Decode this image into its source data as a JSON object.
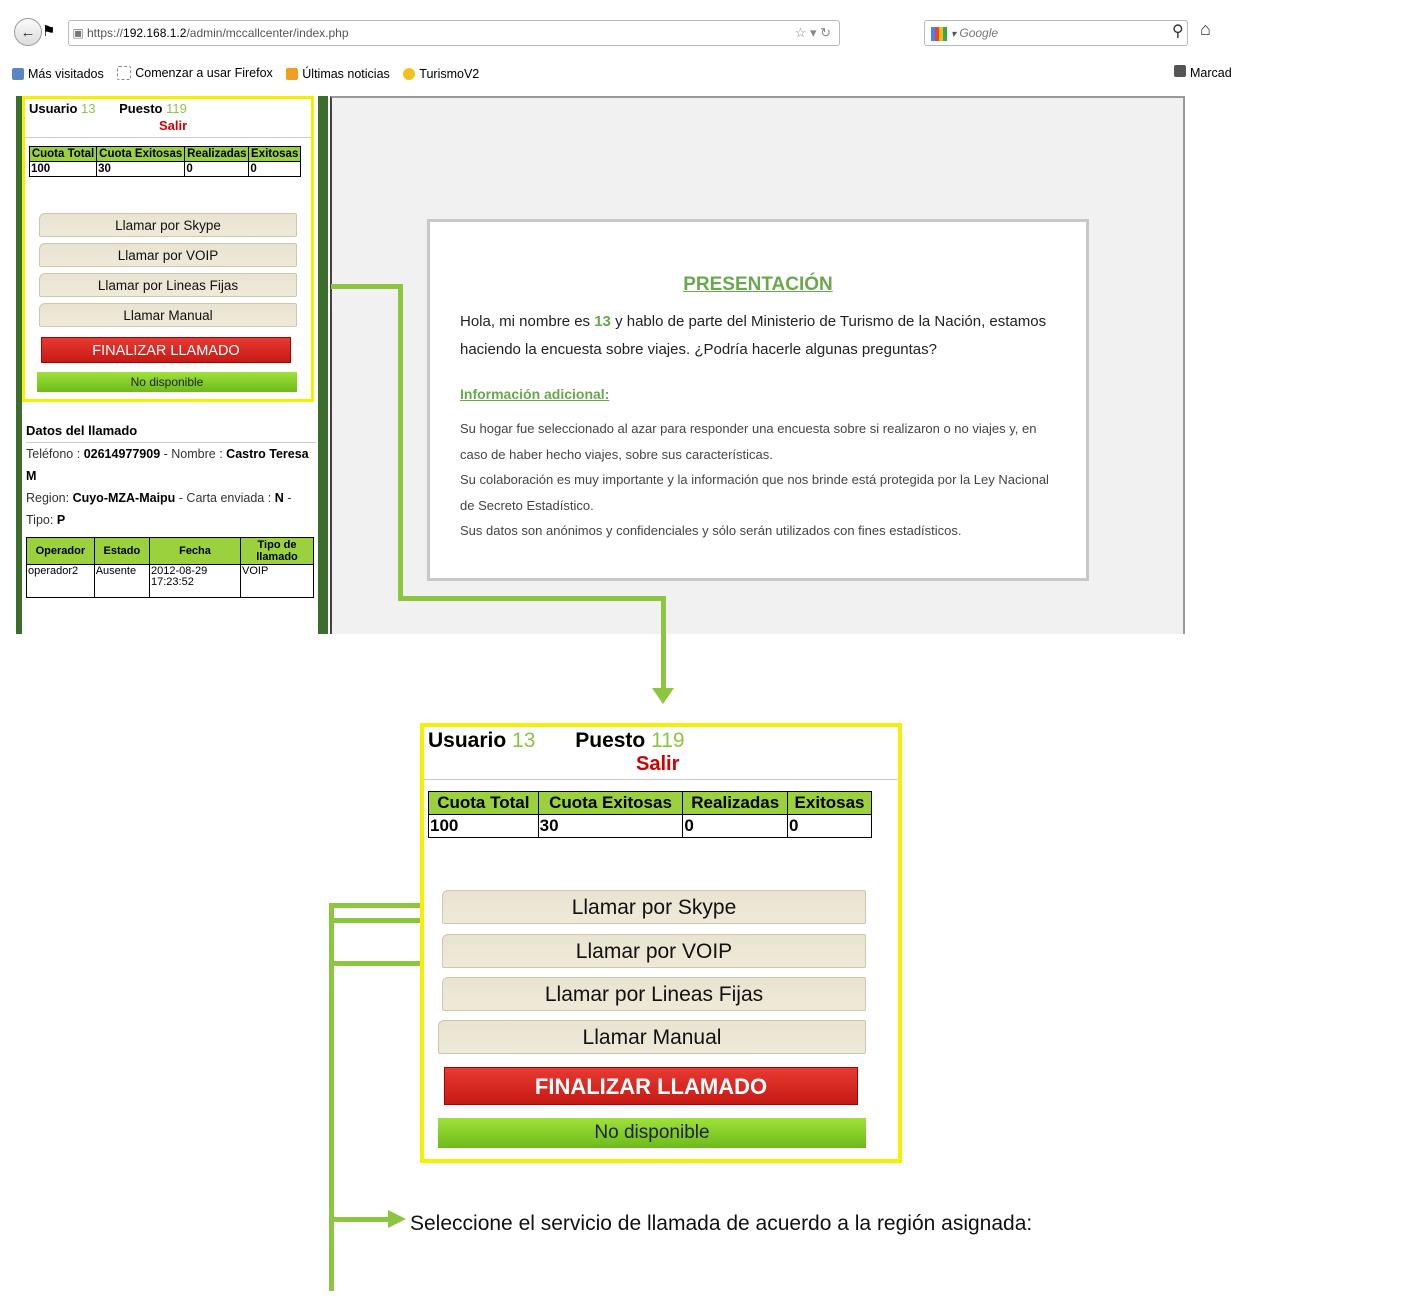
{
  "browser": {
    "url_prefix": "https://",
    "url_host": "192.168.1.2",
    "url_path": "/admin/mccallcenter/index.php",
    "search_placeholder": "Google",
    "bookmarks": [
      "Más visitados",
      "Comenzar a usar Firefox",
      "Últimas noticias",
      "TurismoV2"
    ],
    "bookmarks_right": "Marcad"
  },
  "panel": {
    "usuario_label": "Usuario",
    "usuario_value": "13",
    "puesto_label": "Puesto",
    "puesto_value": "119",
    "salir": "Salir",
    "quota_headers": [
      "Cuota Total",
      "Cuota Exitosas",
      "Realizadas",
      "Exitosas"
    ],
    "quota_values": [
      "100",
      "30",
      "0",
      "0"
    ],
    "buttons": [
      "Llamar por Skype",
      "Llamar por VOIP",
      "Llamar por Lineas Fijas",
      "Llamar Manual"
    ],
    "finalizar": "FINALIZAR LLAMADO",
    "status": "No disponible"
  },
  "datos": {
    "title": "Datos del llamado",
    "telefono_label": "Teléfono : ",
    "telefono": "02614977909",
    "nombre_label": " - Nombre : ",
    "nombre": "Castro Teresa M",
    "region_label": "Region: ",
    "region": "Cuyo-MZA-Maipu",
    "carta_label": " - Carta enviada : ",
    "carta": "N",
    "tipo_label": " - Tipo: ",
    "tipo": "P",
    "table_headers": [
      "Operador",
      "Estado",
      "Fecha",
      "Tipo de llamado"
    ],
    "table_row": [
      "operador2",
      "Ausente",
      "2012-08-29 17:23:52",
      "VOIP"
    ]
  },
  "presentacion": {
    "title": "PRESENTACIÓN",
    "intro_a": "Hola, mi nombre es ",
    "intro_num": "13",
    "intro_b": " y hablo de parte del Ministerio de Turismo de la Nación, estamos haciendo la encuesta sobre viajes. ¿Podría hacerle algunas preguntas?",
    "addl_title": "Información adicional:",
    "addl_p1": "Su hogar fue seleccionado al azar para responder una encuesta sobre si realizaron o no viajes y, en caso de haber hecho viajes, sobre sus características.",
    "addl_p2": "Su colaboración es muy importante y la información que nos brinde está protegida por la Ley Nacional de Secreto Estadístico.",
    "addl_p3": "Sus datos son anónimos y confidenciales y sólo serán utilizados con fines estadísticos."
  },
  "caption": "Seleccione el servicio de llamada de acuerdo a la región asignada:"
}
